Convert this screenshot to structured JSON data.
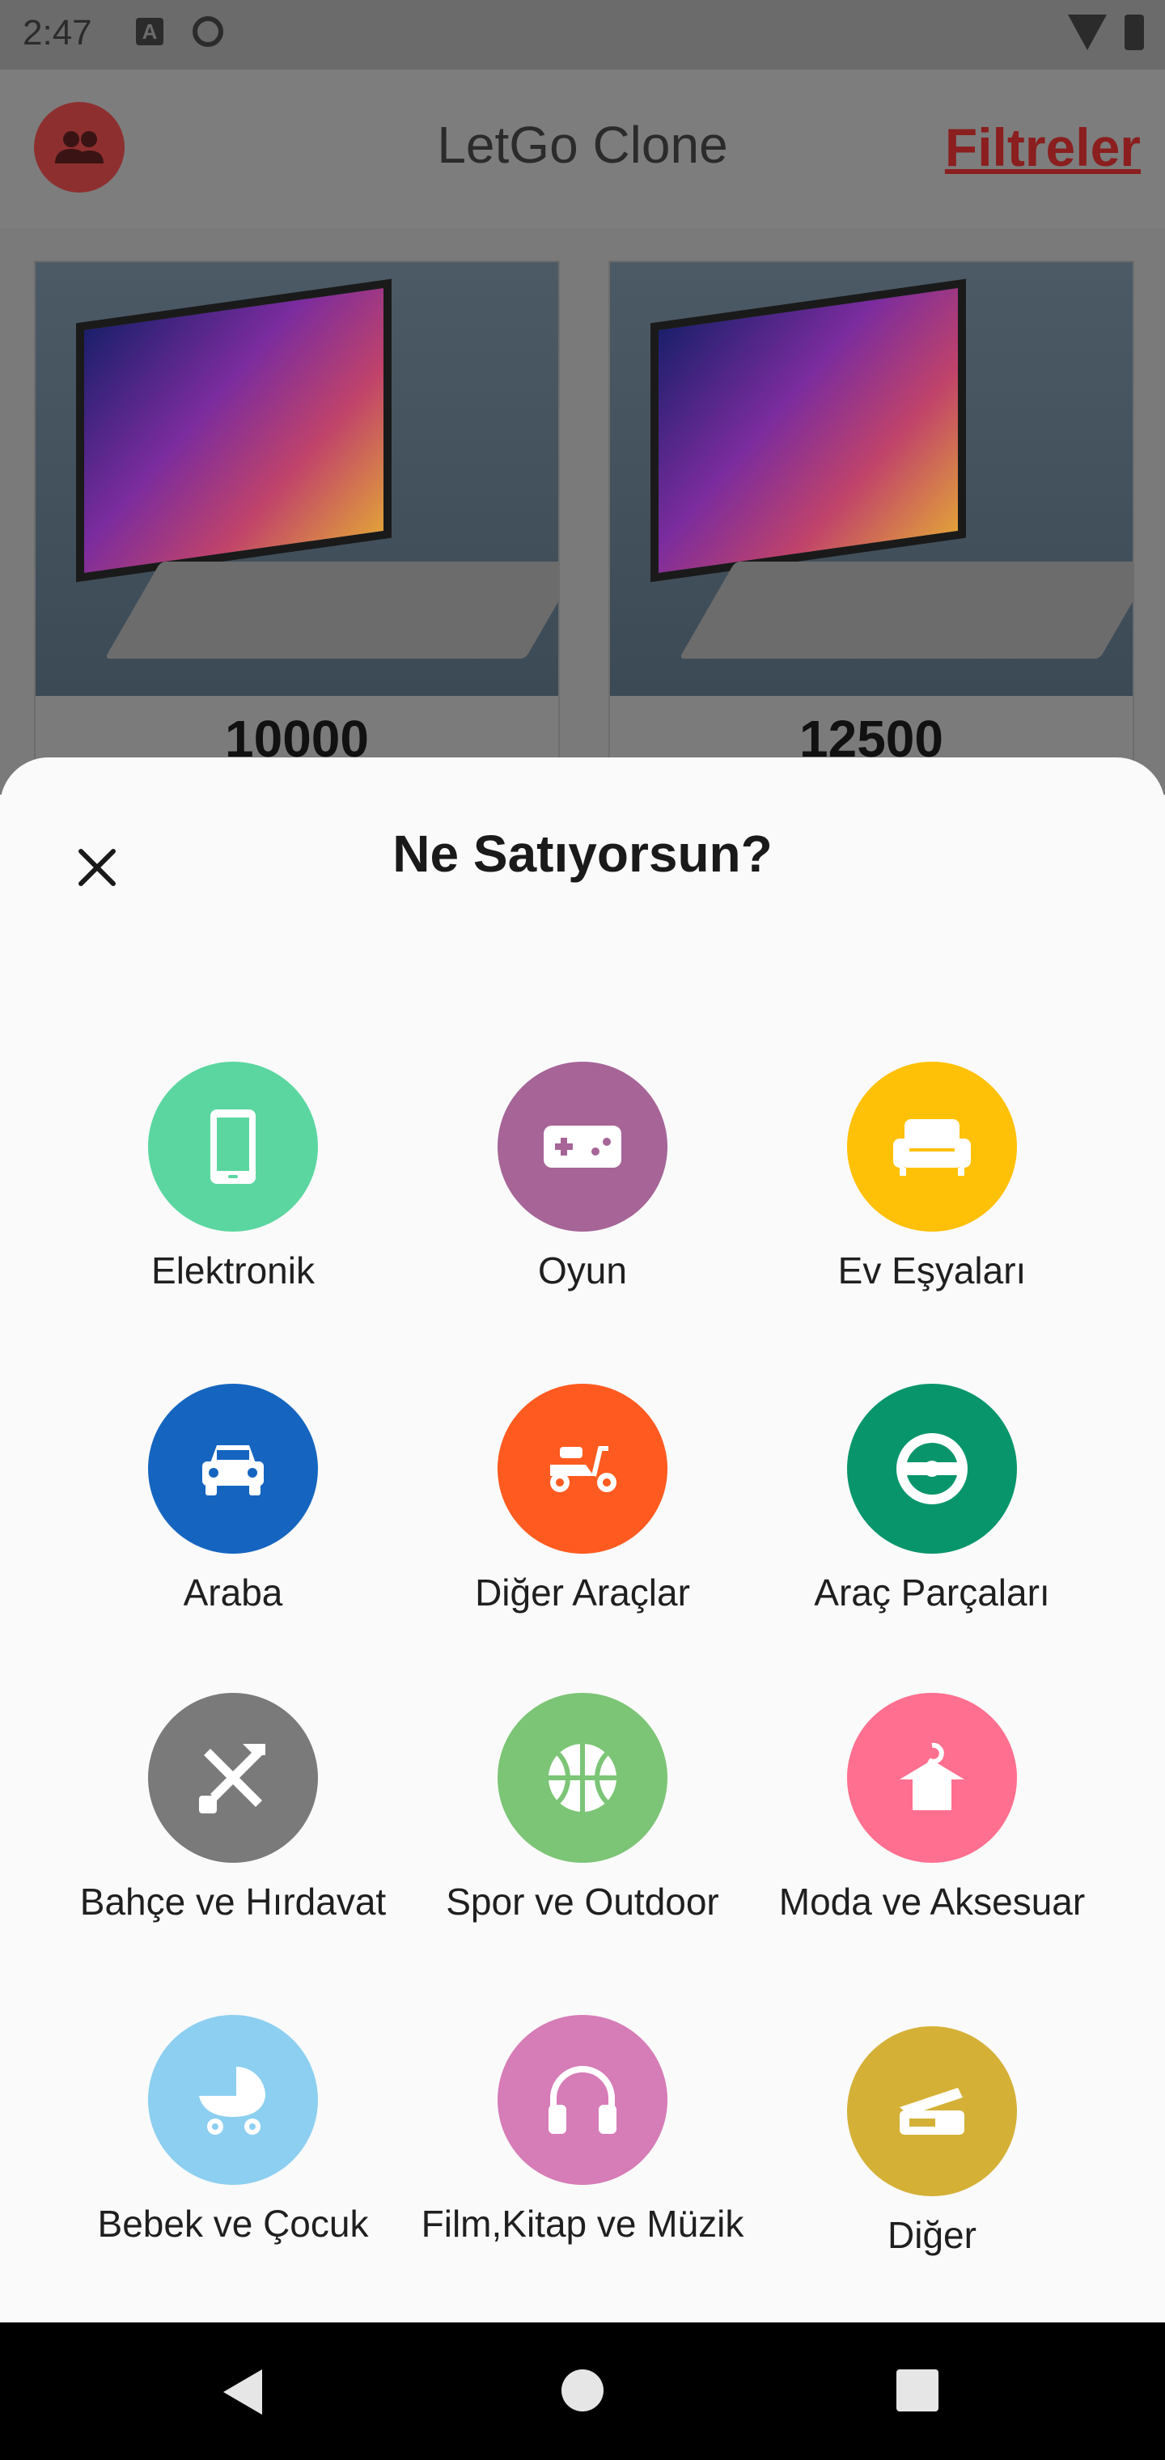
{
  "status_bar": {
    "time": "2:47",
    "a_glyph": "A"
  },
  "app_bar": {
    "title": "LetGo Clone",
    "filters_label": "Filtreler"
  },
  "products": [
    {
      "price": "10000"
    },
    {
      "price": "12500"
    }
  ],
  "sheet": {
    "title": "Ne Satıyorsun?",
    "categories": [
      {
        "label": "Elektronik",
        "color": "#5bd6a0",
        "icon": "phone-icon"
      },
      {
        "label": "Oyun",
        "color": "#a66497",
        "icon": "gamepad-icon"
      },
      {
        "label": "Ev Eşyaları",
        "color": "#ffc107",
        "icon": "sofa-icon"
      },
      {
        "label": "Araba",
        "color": "#1565c0",
        "icon": "car-icon"
      },
      {
        "label": "Diğer Araçlar",
        "color": "#ff5a1f",
        "icon": "scooter-icon"
      },
      {
        "label": "Araç Parçaları",
        "color": "#08956b",
        "icon": "steering-icon"
      },
      {
        "label": "Bahçe ve Hırdavat",
        "color": "#7a7a7a",
        "icon": "tools-icon"
      },
      {
        "label": "Spor ve Outdoor",
        "color": "#7cc576",
        "icon": "ball-icon"
      },
      {
        "label": "Moda ve Aksesuar",
        "color": "#ff6f8f",
        "icon": "hanger-icon"
      },
      {
        "label": "Bebek ve Çocuk",
        "color": "#8ccff0",
        "icon": "stroller-icon"
      },
      {
        "label": "Film,Kitap ve Müzik",
        "color": "#d67cb7",
        "icon": "headphones-icon"
      },
      {
        "label": "Diğer",
        "color": "#d4b036",
        "icon": "other-icon"
      }
    ]
  }
}
